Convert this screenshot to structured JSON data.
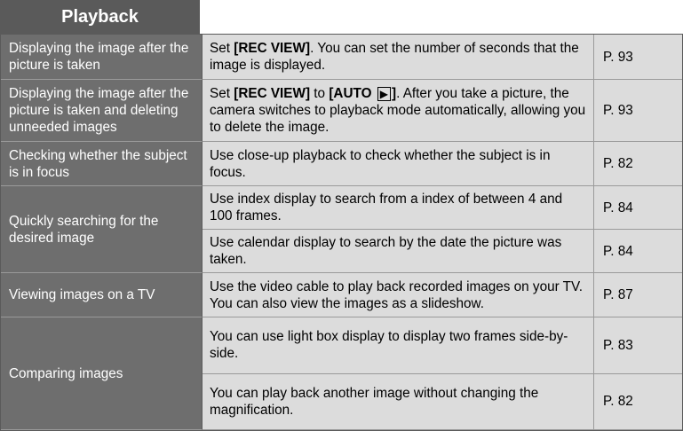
{
  "tab": {
    "label": "Playback"
  },
  "rows": [
    {
      "feature": "Displaying the image after the picture is taken",
      "desc_pre": "Set ",
      "desc_bold": "[REC VIEW]",
      "desc_post": ". You can set the number of seconds that the image is displayed.",
      "page": "P. 93"
    },
    {
      "feature": "Displaying the image after the picture is taken and deleting unneeded images",
      "desc_pre": "Set ",
      "desc_bold": "[REC VIEW]",
      "desc_mid": " to ",
      "desc_bold2": "[AUTO",
      "desc_icon": "play-icon",
      "desc_bold3": "]",
      "desc_post": ". After you take a picture, the camera switches to playback mode automatically, allowing you to delete the image.",
      "page": "P. 93"
    },
    {
      "feature": "Checking whether the subject is in focus",
      "desc": "Use close-up playback to check whether the subject is in focus.",
      "page": "P. 82"
    },
    {
      "feature": "Quickly searching for the desired image",
      "subrows": [
        {
          "desc": "Use index display to search from a index of between 4 and 100 frames.",
          "page": "P. 84"
        },
        {
          "desc": "Use calendar display to search by the date the picture was taken.",
          "page": "P. 84"
        }
      ]
    },
    {
      "feature": "Viewing images on a TV",
      "desc": "Use the video cable to play back recorded images on your TV. You can also view the images as a slideshow.",
      "page": "P. 87"
    },
    {
      "feature": "Comparing images",
      "subrows": [
        {
          "desc": "You can use light box display to display two frames side-by-side.",
          "page": "P. 83"
        },
        {
          "desc": "You can play back another image without changing the magnification.",
          "page": "P. 82"
        }
      ]
    }
  ]
}
